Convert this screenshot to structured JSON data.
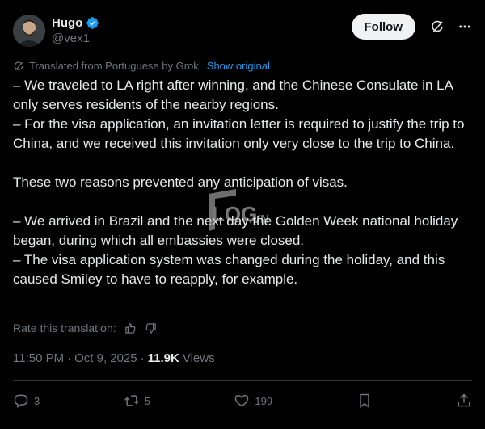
{
  "author": {
    "name": "Hugo",
    "handle": "@vex1_",
    "verified": true
  },
  "header": {
    "follow_label": "Follow"
  },
  "translation": {
    "notice": "Translated from Portuguese by Grok",
    "show_original": "Show original",
    "rate_label": "Rate this translation:"
  },
  "post": {
    "paragraphs": [
      "– We traveled to LA right after winning, and the Chinese Consulate in LA only serves residents of the nearby regions.",
      "– For the visa application, an invitation letter is required to justify the trip to China, and we received this invitation only very close to the trip to China.",
      "",
      "These two reasons prevented any anticipation of visas.",
      "",
      "– We arrived in Brazil and the next day the Golden Week national holiday began, during which all embassies were closed.",
      "– The visa application system was changed during the holiday, and this caused Smiley to have to reapply, for example."
    ]
  },
  "meta": {
    "time": "11:50 PM",
    "date": "Oct 9, 2025",
    "views_count": "11.9K",
    "views_label": "Views",
    "separator": "·"
  },
  "actions": {
    "replies": "3",
    "reposts": "5",
    "likes": "199"
  },
  "watermark": {
    "text": "LOG.VN"
  },
  "colors": {
    "background": "#000000",
    "text": "#e7e9ea",
    "muted": "#71767b",
    "link": "#1d9bf0",
    "verified": "#1d9bf0",
    "follow_bg": "#eff3f4"
  },
  "icons": [
    "verified-badge-icon",
    "grok-icon",
    "more-icon",
    "thumbs-up-icon",
    "thumbs-down-icon",
    "reply-icon",
    "repost-icon",
    "like-icon",
    "bookmark-icon",
    "share-icon"
  ]
}
